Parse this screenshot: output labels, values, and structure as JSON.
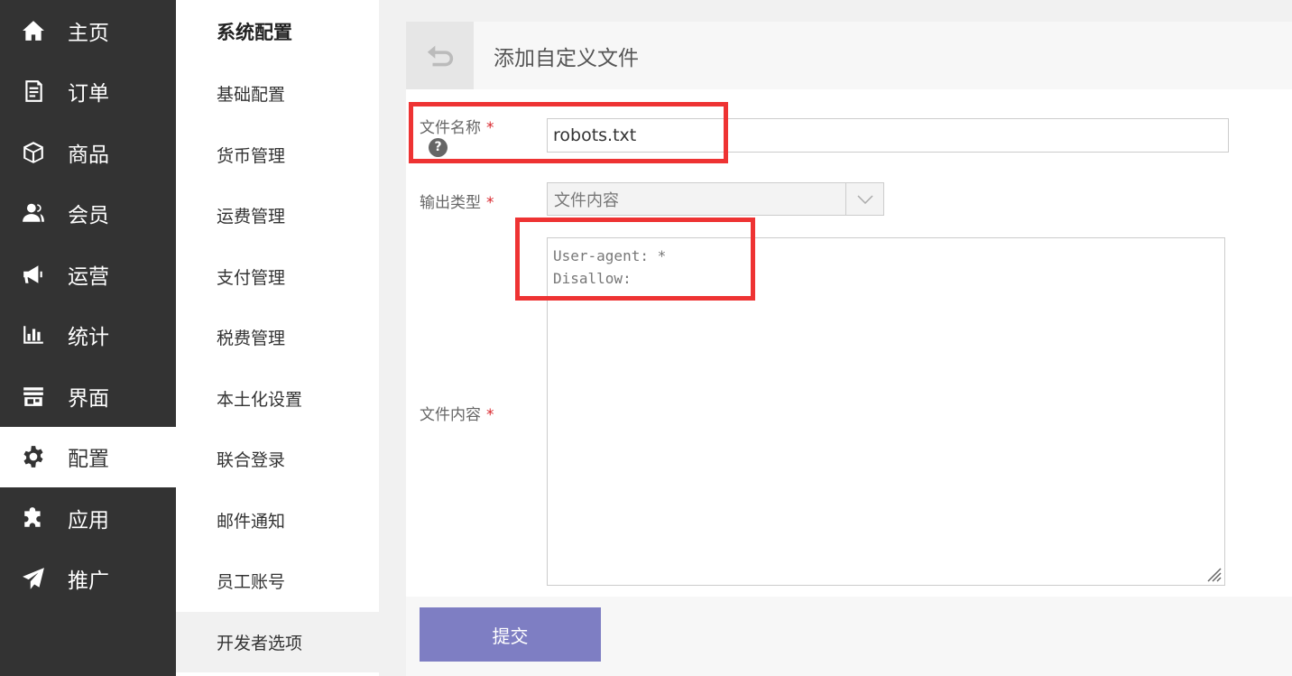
{
  "main_nav": {
    "items": [
      {
        "label": "主页",
        "icon": "home-icon"
      },
      {
        "label": "订单",
        "icon": "order-icon"
      },
      {
        "label": "商品",
        "icon": "box-icon"
      },
      {
        "label": "会员",
        "icon": "users-icon"
      },
      {
        "label": "运营",
        "icon": "megaphone-icon"
      },
      {
        "label": "统计",
        "icon": "bar-chart-icon"
      },
      {
        "label": "界面",
        "icon": "storefront-icon"
      },
      {
        "label": "配置",
        "icon": "gear-icon",
        "active": true
      },
      {
        "label": "应用",
        "icon": "puzzle-icon"
      },
      {
        "label": "推广",
        "icon": "paper-plane-icon"
      }
    ]
  },
  "sub_nav": {
    "title": "系统配置",
    "items": [
      {
        "label": "基础配置"
      },
      {
        "label": "货币管理"
      },
      {
        "label": "运费管理"
      },
      {
        "label": "支付管理"
      },
      {
        "label": "税费管理"
      },
      {
        "label": "本土化设置"
      },
      {
        "label": "联合登录"
      },
      {
        "label": "邮件通知"
      },
      {
        "label": "员工账号"
      },
      {
        "label": "开发者选项",
        "active": true
      }
    ]
  },
  "panel": {
    "title": "添加自定义文件",
    "back_icon": "back-arrow-icon"
  },
  "form": {
    "file_name_label": "文件名称",
    "file_name_value": "robots.txt",
    "help_glyph": "?",
    "output_type_label": "输出类型",
    "output_type_value": "文件内容",
    "file_content_label": "文件内容",
    "file_content_value": "User-agent: *\nDisallow:",
    "required_mark": "*",
    "submit_label": "提交"
  },
  "colors": {
    "main_nav_bg": "#333333",
    "accent_button": "#7e7ec3",
    "highlight_box": "#ee3333",
    "required": "#d9262c"
  }
}
